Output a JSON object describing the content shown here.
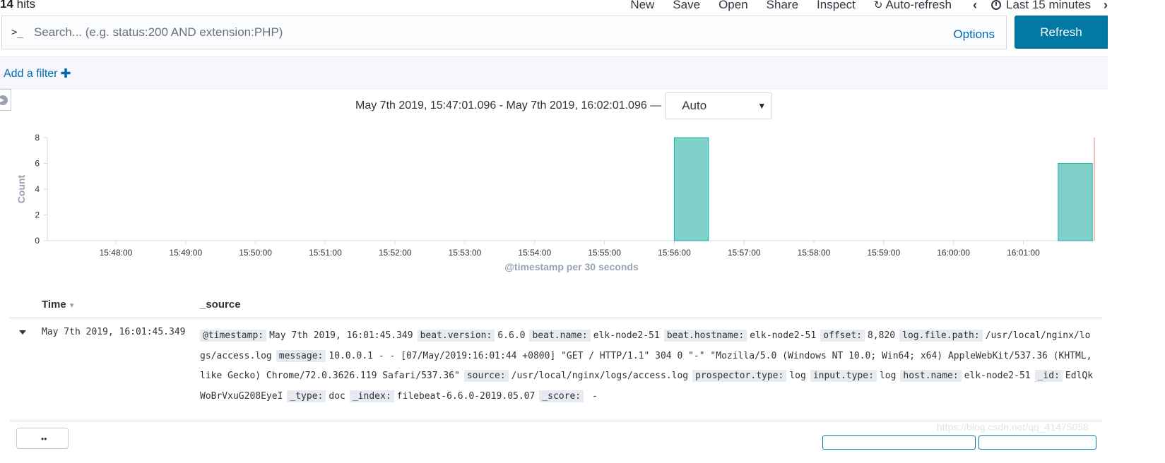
{
  "hits": {
    "count": "14",
    "label": "hits"
  },
  "topnav": {
    "new": "New",
    "save": "Save",
    "open": "Open",
    "share": "Share",
    "inspect": "Inspect",
    "auto_refresh": "Auto-refresh",
    "time_range": "Last 15 minutes"
  },
  "query": {
    "prompt": ">_",
    "placeholder": "Search... (e.g. status:200 AND extension:PHP)",
    "options": "Options",
    "refresh": "Refresh"
  },
  "filter": {
    "add_filter": "Add a filter"
  },
  "histogram": {
    "range_text": "May 7th 2019, 15:47:01.096 - May 7th 2019, 16:02:01.096 —",
    "interval": "Auto"
  },
  "chart_data": {
    "type": "bar",
    "ylabel": "Count",
    "xlabel": "@timestamp per 30 seconds",
    "ylim": [
      0,
      8
    ],
    "y_ticks": [
      "0",
      "2",
      "4",
      "6",
      "8"
    ],
    "x_ticks": [
      "15:48:00",
      "15:49:00",
      "15:50:00",
      "15:51:00",
      "15:52:00",
      "15:53:00",
      "15:54:00",
      "15:55:00",
      "15:56:00",
      "15:57:00",
      "15:58:00",
      "15:59:00",
      "16:00:00",
      "16:01:00"
    ],
    "x_range": [
      "15:47:01.096",
      "16:02:01.096"
    ],
    "bars": [
      {
        "start": "15:56:00",
        "end": "15:56:30",
        "value": 8
      },
      {
        "start": "16:01:30",
        "end": "16:02:00",
        "value": 6
      }
    ],
    "bar_color": "#7fd1c9",
    "bar_stroke": "#1eb2a3",
    "now_marker_color": "#f3a6a6",
    "grid": false
  },
  "table": {
    "col_time": "Time",
    "col_source": "_source",
    "rows": [
      {
        "time": "May 7th 2019, 16:01:45.349",
        "fields": [
          {
            "k": "@timestamp:",
            "v": "May 7th 2019, 16:01:45.349"
          },
          {
            "k": "beat.version:",
            "v": "6.6.0"
          },
          {
            "k": "beat.name:",
            "v": "elk-node2-51"
          },
          {
            "k": "beat.hostname:",
            "v": "elk-node2-51"
          },
          {
            "k": "offset:",
            "v": "8,820"
          },
          {
            "k": "log.file.path:",
            "v": "/usr/local/nginx/logs/access.log"
          },
          {
            "k": "message:",
            "v": "10.0.0.1 - - [07/May/2019:16:01:44 +0800] \"GET / HTTP/1.1\" 304 0 \"-\" \"Mozilla/5.0 (Windows NT 10.0; Win64; x64) AppleWebKit/537.36 (KHTML, like Gecko) Chrome/72.0.3626.119 Safari/537.36\""
          },
          {
            "k": "source:",
            "v": "/usr/local/nginx/logs/access.log"
          },
          {
            "k": "prospector.type:",
            "v": "log"
          },
          {
            "k": "input.type:",
            "v": "log"
          },
          {
            "k": "host.name:",
            "v": "elk-node2-51"
          },
          {
            "k": "_id:",
            "v": "EdlQkWoBrVxuG208EyeI"
          },
          {
            "k": "_type:",
            "v": "doc"
          },
          {
            "k": "_index:",
            "v": "filebeat-6.6.0-2019.05.07"
          },
          {
            "k": "_score:",
            "v": " - "
          }
        ]
      }
    ]
  },
  "watermark": "https://blog.csdn.net/qq_41475058",
  "colors": {
    "accent": "#006bb4",
    "button": "#0079a5"
  }
}
